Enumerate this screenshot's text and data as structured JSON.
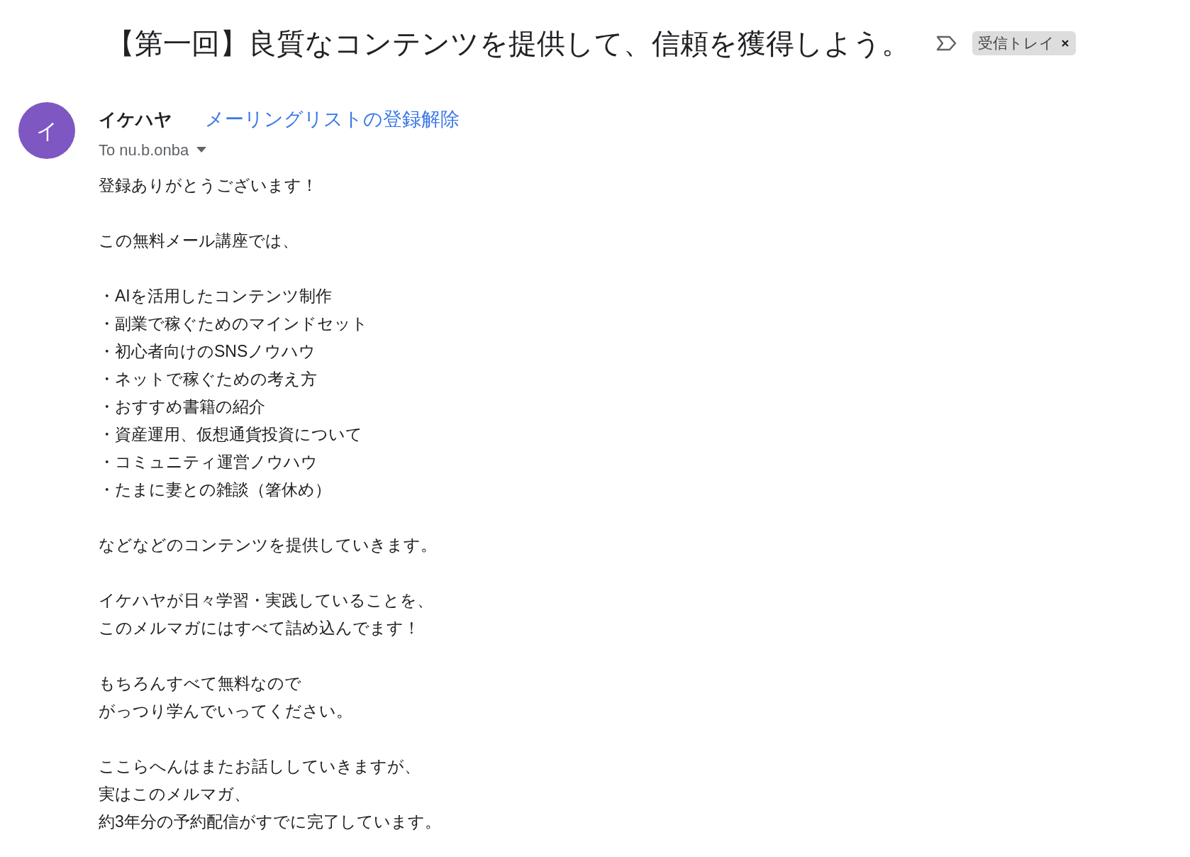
{
  "subject": "【第一回】良質なコンテンツを提供して、信頼を獲得しよう。",
  "label": {
    "text": "受信トレイ"
  },
  "sender": {
    "avatar_letter": "イ",
    "name": "イケハヤ",
    "unsubscribe": "メーリングリストの登録解除",
    "to": "To nu.b.onba"
  },
  "body": [
    [
      "登録ありがとうございます！"
    ],
    [
      "この無料メール講座では、"
    ],
    [
      "・AIを活用したコンテンツ制作",
      "・副業で稼ぐためのマインドセット",
      "・初心者向けのSNSノウハウ",
      "・ネットで稼ぐための考え方",
      "・おすすめ書籍の紹介",
      "・資産運用、仮想通貨投資について",
      "・コミュニティ運営ノウハウ",
      "・たまに妻との雑談（箸休め）"
    ],
    [
      "などなどのコンテンツを提供していきます。"
    ],
    [
      "イケハヤが日々学習・実践していることを、",
      "このメルマガにはすべて詰め込んでます！"
    ],
    [
      "もちろんすべて無料なので",
      "がっつり学んでいってください。"
    ],
    [
      "ここらへんはまたお話ししていきますが、",
      "実はこのメルマガ、",
      "約3年分の予約配信がすでに完了しています。"
    ]
  ]
}
